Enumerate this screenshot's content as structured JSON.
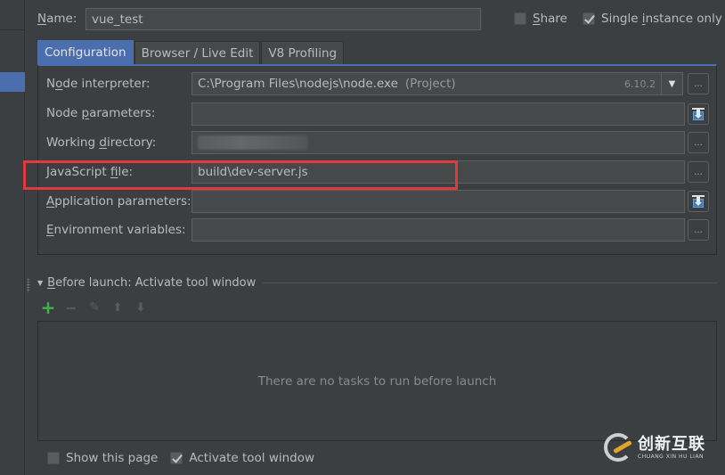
{
  "header": {
    "name_label": "Name:",
    "name_mnemonic": "N",
    "name_rest": "ame:",
    "name_value": "vue_test",
    "share": {
      "mnemonic": "S",
      "rest": "hare",
      "checked": false
    },
    "single_instance": {
      "before": "Single ",
      "mnemonic": "i",
      "after": "nstance only",
      "checked": true
    }
  },
  "tabs": [
    {
      "label": "Configuration",
      "active": true
    },
    {
      "label": "Browser / Live Edit",
      "active": false
    },
    {
      "label": "V8 Profiling",
      "active": false
    }
  ],
  "config": {
    "node_interpreter": {
      "label_before": "N",
      "mnemonic": "o",
      "label_after": "de interpreter:",
      "value": "C:\\Program Files\\nodejs\\node.exe",
      "suffix": "(Project)",
      "version": "6.10.2",
      "browse_label": "..."
    },
    "node_parameters": {
      "label_before": "Node ",
      "mnemonic": "p",
      "label_after": "arameters:",
      "value": ""
    },
    "working_directory": {
      "label_before": "Working ",
      "mnemonic": "d",
      "label_after": "irectory:",
      "value": "",
      "browse_label": "..."
    },
    "javascript_file": {
      "label_before": "JavaScript ",
      "mnemonic": "f",
      "label_after": "ile:",
      "value": "build\\dev-server.js",
      "browse_label": "..."
    },
    "application_parameters": {
      "label_before": "",
      "mnemonic": "A",
      "label_after": "pplication parameters:",
      "value": ""
    },
    "environment_variables": {
      "label_before": "",
      "mnemonic": "E",
      "label_after": "nvironment variables:",
      "value": "",
      "browse_label": "..."
    }
  },
  "before_launch": {
    "mnemonic": "B",
    "title_rest": "efore launch: Activate tool window",
    "toolbar": {
      "add": "+",
      "remove": "−",
      "edit": "✎",
      "up": "⬆",
      "down": "⬇"
    },
    "empty_message": "There are no tasks to run before launch"
  },
  "footer": {
    "show_page": {
      "label": "Show this page",
      "checked": false
    },
    "activate_tool_window": {
      "label": "Activate tool window",
      "checked": true
    }
  },
  "watermark": {
    "cn": "创新互联",
    "en": "CHUANG XIN HU LIAN"
  },
  "colors": {
    "accent": "#4b6eaf",
    "highlight": "#e0393e",
    "add_green": "#3fb24b",
    "background": "#3c3f41"
  }
}
